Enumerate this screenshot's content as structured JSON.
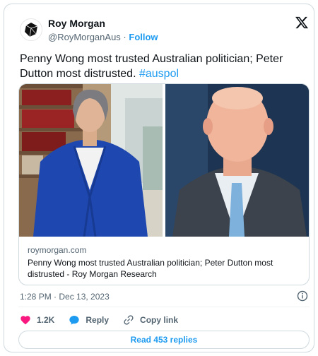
{
  "author": {
    "name": "Roy Morgan",
    "handle": "@RoyMorganAus",
    "separator": "·",
    "follow_label": "Follow"
  },
  "tweet": {
    "text": "Penny Wong most trusted Australian politician; Peter Dutton most distrusted.",
    "hashtag": "#auspol"
  },
  "link_card": {
    "domain": "roymorgan.com",
    "title": "Penny Wong most trusted Australian politician; Peter Dutton most distrusted - Roy Morgan Research"
  },
  "meta": {
    "timestamp": "1:28 PM · Dec 13, 2023"
  },
  "actions": {
    "likes": "1.2K",
    "reply_label": "Reply",
    "copy_link_label": "Copy link"
  },
  "read_replies_label": "Read 453 replies",
  "colors": {
    "accent": "#1d9bf0",
    "like_heart": "#f91880",
    "text": "#0f1419",
    "secondary": "#536471",
    "border": "#cfd9de"
  },
  "icons": [
    "roy-morgan-logo",
    "x-logo-icon",
    "info-icon",
    "heart-icon",
    "reply-icon",
    "link-icon"
  ]
}
